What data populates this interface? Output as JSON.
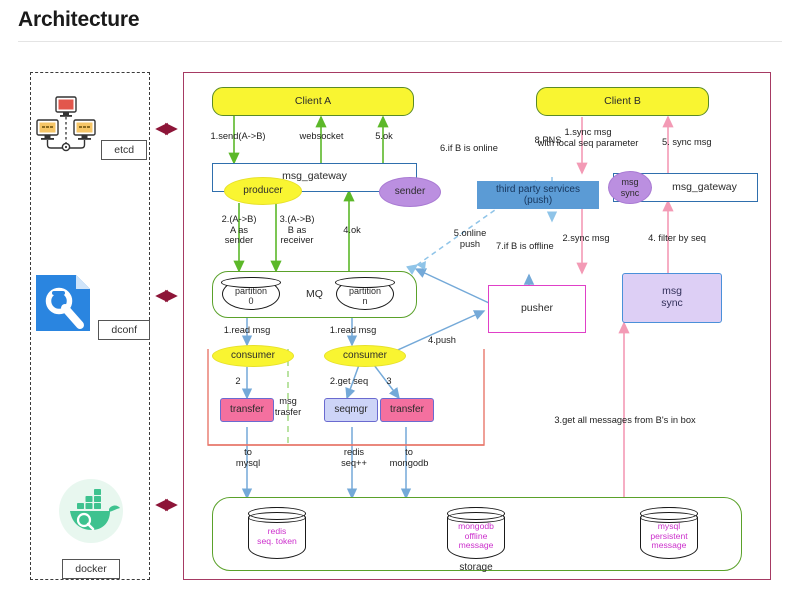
{
  "page": {
    "title": "Architecture"
  },
  "infra": {
    "items": [
      {
        "label": "etcd",
        "icon": "etcd-cluster-icon"
      },
      {
        "label": "dconf",
        "icon": "dconf-wrench-icon"
      },
      {
        "label": "docker",
        "icon": "docker-whale-icon"
      }
    ]
  },
  "diagram": {
    "nodes": {
      "client_a": "Client A",
      "client_b": "Client B",
      "msg_gateway_left": "msg_gateway",
      "msg_gateway_right": "msg_gateway",
      "producer": "producer",
      "sender": "sender",
      "msg_sync_ellipse": "msg\nsync",
      "mq": "MQ",
      "partition_0": "partition\n0",
      "partition_n": "partition\nn",
      "consumer_left": "consumer",
      "consumer_right": "consumer",
      "transfer_left": "transfer",
      "seqmgr": "seqmgr",
      "transfer_right": "transfer",
      "third_party": "third party services\n(push)",
      "pusher": "pusher",
      "msg_sync_box": "msg\nsync",
      "storage": "storage",
      "db_redis": "redis\nseq. token",
      "db_mongodb": "mongodb\noffline\nmessage",
      "db_mysql": "mysql\npersistent\nmessage"
    },
    "edge_labels": {
      "send_a_b": "1.send(A->B)",
      "websocket": "websocket",
      "ok5": "5.ok",
      "a_as_sender": "2.(A->B)\nA as\nsender",
      "b_as_receiver": "3.(A->B)\nB as\nreceiver",
      "ok4": "4.ok",
      "read_msg_left": "1.read msg",
      "read_msg_right": "1.read msg",
      "two": "2",
      "get_seq": "2.get seq",
      "three": "3",
      "msg_transfer": "msg\ntrasfer",
      "to_mysql": "to\nmysql",
      "redis_seq": "redis\nseq++",
      "to_mongodb": "to\nmongodb",
      "push4": "4.push",
      "if_b_online": "6.if B is online",
      "pns": "8.PNS",
      "online_push": "5.online\npush",
      "if_b_offline": "7.if B is offline",
      "sync_msg_local_seq": "1.sync msg\nwith local seq parameter",
      "sync_msg_5": "5. sync msg",
      "sync_msg_2": "2.sync msg",
      "filter_by_seq": "4. filter by seq",
      "get_all_messages": "3.get all messages from B's in box"
    }
  },
  "colors": {
    "panel_border": "#a63a63",
    "client_fill": "#f9f531",
    "client_border": "#5a8a27",
    "gateway_border": "#2f6fad",
    "purple_fill": "#bb8fe0",
    "green_arrow": "#5cb829",
    "blue_arrow": "#74a9d8",
    "pink_arrow": "#f39ab5",
    "dark_red_arrow": "#8d1538",
    "transfer_fill": "#f4709f",
    "seqmgr_fill": "#cdd4f7",
    "third_party_fill": "#5b9bd5",
    "pusher_border": "#e040c8",
    "msgsync_fill": "#ddcff5",
    "storage_border": "#5aa12a",
    "db_text": "#cc30cc"
  }
}
